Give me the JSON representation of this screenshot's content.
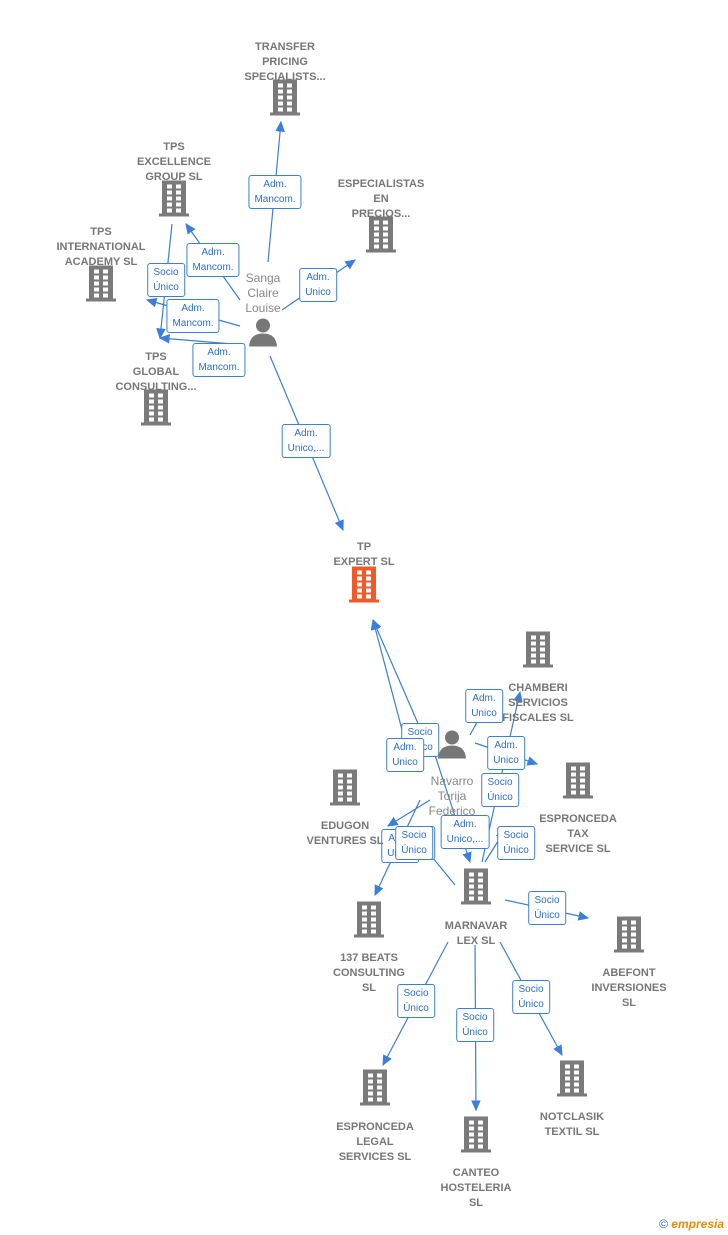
{
  "colors": {
    "edge": "#3a7fd9",
    "company": "#7a7a7a",
    "focus": "#f05a28",
    "person": "#777777"
  },
  "nodes": [
    {
      "id": "transfer",
      "type": "company",
      "label": "TRANSFER\nPRICING\nSPECIALISTS..."
    },
    {
      "id": "excellence",
      "type": "company",
      "label": "TPS\nEXCELLENCE\nGROUP  SL"
    },
    {
      "id": "especialistas",
      "type": "company",
      "label": "ESPECIALISTAS\nEN\nPRECIOS..."
    },
    {
      "id": "academy",
      "type": "company",
      "label": "TPS\nINTERNATIONAL\nACADEMY  SL"
    },
    {
      "id": "sanga",
      "type": "person",
      "label": "Sanga\nClaire\nLouise"
    },
    {
      "id": "global",
      "type": "company",
      "label": "TPS\nGLOBAL\nCONSULTING..."
    },
    {
      "id": "tpexpert",
      "type": "focus",
      "label": "TP\nEXPERT  SL"
    },
    {
      "id": "chamberi",
      "type": "company",
      "label": "CHAMBERI\nSERVICIOS\nFISCALES  SL"
    },
    {
      "id": "navarro",
      "type": "person",
      "label": "Navarro\nTorija\nFederico"
    },
    {
      "id": "esptax",
      "type": "company",
      "label": "ESPRONCEDA\nTAX\nSERVICE  SL"
    },
    {
      "id": "edugon",
      "type": "company",
      "label": "EDUGON\nVENTURES  SL"
    },
    {
      "id": "marnavar",
      "type": "company",
      "label": "MARNAVAR\nLEX  SL"
    },
    {
      "id": "beats",
      "type": "company",
      "label": "137 BEATS\nCONSULTING\nSL"
    },
    {
      "id": "abefont",
      "type": "company",
      "label": "ABEFONT\nINVERSIONES\nSL"
    },
    {
      "id": "esplegal",
      "type": "company",
      "label": "ESPRONCEDA\nLEGAL\nSERVICES  SL"
    },
    {
      "id": "notclasik",
      "type": "company",
      "label": "NOTCLASIK\nTEXTIL  SL"
    },
    {
      "id": "canteo",
      "type": "company",
      "label": "CANTEO\nHOSTELERIA\nSL"
    }
  ],
  "edges": [
    {
      "from": "sanga",
      "to": "transfer",
      "label": "Adm.\nMancom."
    },
    {
      "from": "sanga",
      "to": "excellence",
      "label": "Adm.\nMancom."
    },
    {
      "from": "sanga",
      "to": "especialistas",
      "label": "Adm.\nUnico"
    },
    {
      "from": "excellence",
      "to": "global",
      "label": "Socio\nÚnico"
    },
    {
      "from": "sanga",
      "to": "academy",
      "label": "Adm.\nMancom."
    },
    {
      "from": "sanga",
      "to": "global",
      "label": "Adm.\nMancom."
    },
    {
      "from": "sanga",
      "to": "tpexpert",
      "label": "Adm.\nUnico,..."
    },
    {
      "from": "navarro",
      "to": "tpexpert",
      "label": "Socio\nÚnico"
    },
    {
      "from": "navarro",
      "to": "tpexpert",
      "label": "Adm.\nUnico"
    },
    {
      "from": "navarro",
      "to": "chamberi",
      "label": "Adm.\nUnico"
    },
    {
      "from": "marnavar",
      "to": "chamberi",
      "label": "Socio\nÚnico"
    },
    {
      "from": "navarro",
      "to": "esptax",
      "label": "Adm.\nUnico"
    },
    {
      "from": "navarro",
      "to": "marnavar",
      "label": "Adm.\nUnico,..."
    },
    {
      "from": "navarro",
      "to": "edugon",
      "label": "Adm.\nUnico"
    },
    {
      "from": "navarro",
      "to": "beats",
      "label": "Socio\nÚnico"
    },
    {
      "from": "marnavar",
      "to": "esptax",
      "label": "Socio\nÚnico"
    },
    {
      "from": "marnavar",
      "to": "edugon",
      "label": "Socio\nÚnico"
    },
    {
      "from": "marnavar",
      "to": "abefont",
      "label": "Socio\nÚnico"
    },
    {
      "from": "marnavar",
      "to": "esplegal",
      "label": "Socio\nÚnico"
    },
    {
      "from": "marnavar",
      "to": "canteo",
      "label": "Socio\nÚnico"
    },
    {
      "from": "marnavar",
      "to": "notclasik",
      "label": "Socio\nÚnico"
    }
  ],
  "footer": {
    "copyright": "©",
    "brand": "empresia"
  }
}
